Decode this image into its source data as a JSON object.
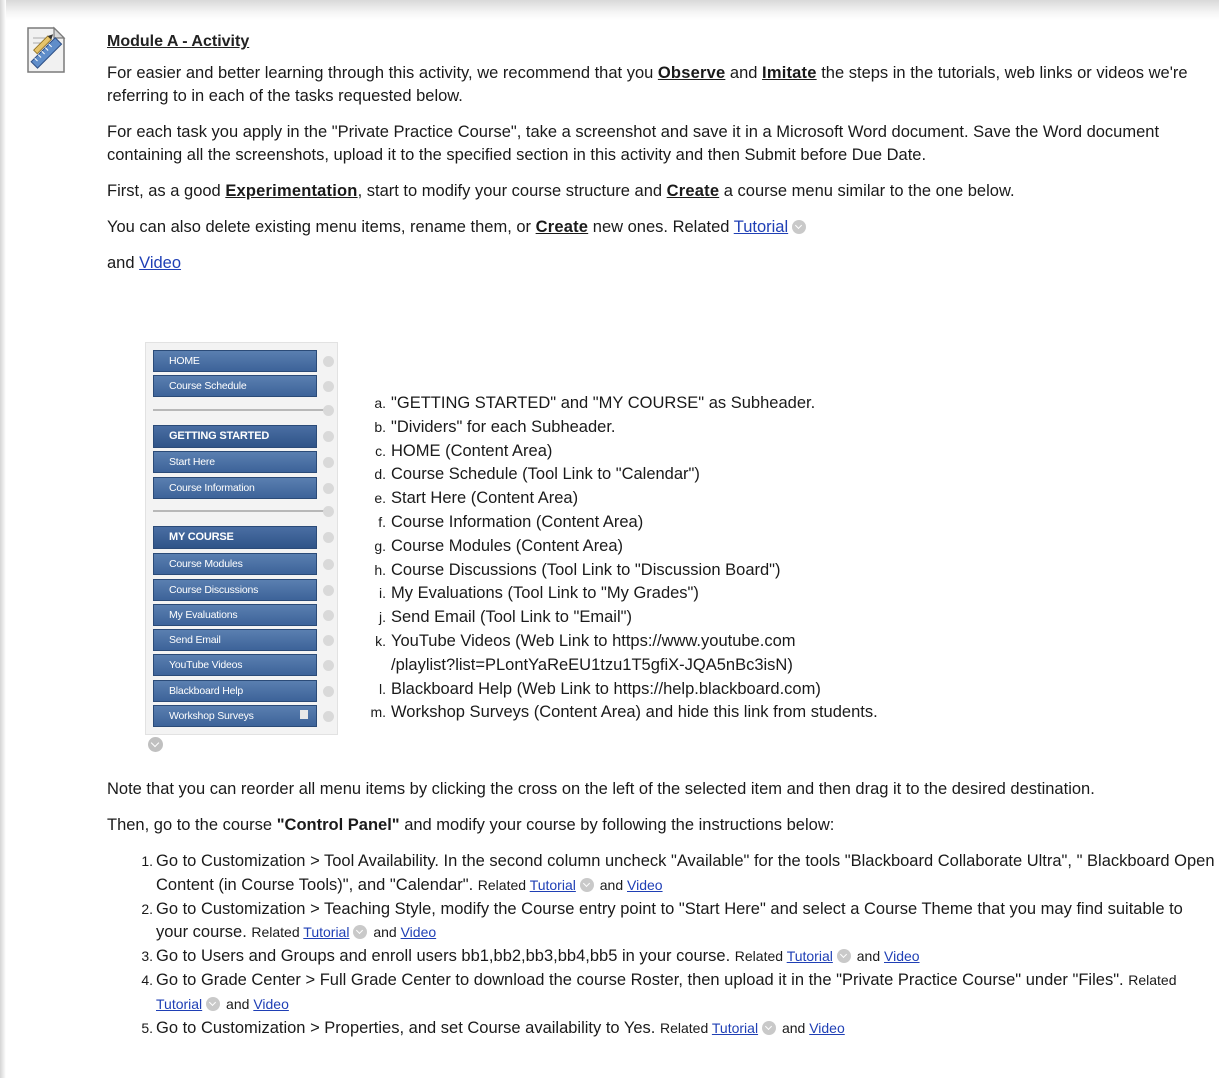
{
  "title": "Module A - Activity",
  "intro": {
    "p1": {
      "t1": "For easier and better learning through this activity, we recommend that you ",
      "kw1": "Observe",
      "t2": " and ",
      "kw2": "Imitate",
      "t3": " the steps in the tutorials, web links or videos we're referring to in each of the tasks requested below."
    },
    "p2": "For each task you apply in the \"Private Practice Course\", take a screenshot and save it in a Microsoft Word document. Save the Word document containing all the screenshots, upload it to the specified section in this activity and then Submit before Due Date.",
    "p3": {
      "t1": "First, as a good ",
      "kw1": "Experimentation",
      "t2": ", start to modify your course structure and ",
      "kw2": "Create",
      "t3": " a course menu similar to the one below."
    },
    "p4": {
      "t1": "You can also delete existing menu items, rename them, or ",
      "kw1": "Create",
      "t2": " new ones. Related ",
      "link": "Tutorial"
    },
    "p5": {
      "t1": "and ",
      "link": "Video"
    }
  },
  "course_menu": [
    {
      "label": "HOME",
      "type": "item"
    },
    {
      "label": "Course Schedule",
      "type": "item"
    },
    {
      "label": "GETTING STARTED",
      "type": "subheader"
    },
    {
      "label": "Start Here",
      "type": "item"
    },
    {
      "label": "Course Information",
      "type": "item"
    },
    {
      "label": "MY COURSE",
      "type": "subheader"
    },
    {
      "label": "Course Modules",
      "type": "item"
    },
    {
      "label": "Course Discussions",
      "type": "item"
    },
    {
      "label": "My Evaluations",
      "type": "item"
    },
    {
      "label": "Send Email",
      "type": "item"
    },
    {
      "label": "YouTube Videos",
      "type": "item"
    },
    {
      "label": "Blackboard Help",
      "type": "item"
    },
    {
      "label": "Workshop Surveys",
      "type": "item"
    }
  ],
  "menu_requirements": [
    {
      "mark": "a.",
      "text": "\"GETTING STARTED\" and \"MY COURSE\" as Subheader."
    },
    {
      "mark": "b.",
      "text": "\"Dividers\" for each Subheader."
    },
    {
      "mark": "c.",
      "text": "HOME (Content Area)"
    },
    {
      "mark": "d.",
      "text": "Course Schedule (Tool Link to \"Calendar\")"
    },
    {
      "mark": "e.",
      "text": "Start Here (Content Area)"
    },
    {
      "mark": "f.",
      "text": "Course Information (Content Area)"
    },
    {
      "mark": "g.",
      "text": "Course Modules (Content Area)"
    },
    {
      "mark": "h.",
      "text": "Course Discussions (Tool Link to \"Discussion Board\")"
    },
    {
      "mark": "i.",
      "text": "My Evaluations (Tool Link to \"My Grades\")"
    },
    {
      "mark": "j.",
      "text": "Send Email (Tool Link to \"Email\")"
    },
    {
      "mark": "k.",
      "text": "YouTube Videos (Web Link to https://www.youtube.com"
    },
    {
      "mark": "",
      "text": "/playlist?list=PLontYaReEU1tzu1T5gfiX-JQA5nBc3isN)"
    },
    {
      "mark": "l.",
      "text": "Blackboard Help (Web Link to https://help.blackboard.com)"
    },
    {
      "mark": "m.",
      "text": "Workshop Surveys (Content Area) and hide this link from students."
    }
  ],
  "note": "Note that you can reorder all menu items by clicking the cross on the left of the selected item and then drag it to the desired destination.",
  "then": {
    "t1": "Then, go to the course ",
    "kw": "\"Control Panel\"",
    "t2": " and modify your course by following the instructions below:"
  },
  "steps": [
    {
      "num": "1.",
      "text": "Go to Customization > Tool Availability. In the second column uncheck \"Available\" for the tools \"Blackboard Collaborate Ultra\", \" Blackboard Open Content (in Course Tools)\", and \"Calendar\". ",
      "related": "Related ",
      "tutorial": "Tutorial",
      "and": " and ",
      "video": "Video"
    },
    {
      "num": "2.",
      "text": "Go to Customization > Teaching Style, modify the Course entry point to \"Start Here\" and select a Course Theme that you may find suitable to your course. ",
      "related": "Related ",
      "tutorial": "Tutorial",
      "and": " and ",
      "video": "Video"
    },
    {
      "num": "3.",
      "text": "Go to Users and Groups and enroll users bb1,bb2,bb3,bb4,bb5 in your course. ",
      "related": "Related ",
      "tutorial": "Tutorial",
      "and": " and ",
      "video": "Video"
    },
    {
      "num": "4.",
      "text": "Go to Grade Center > Full Grade Center to download the course Roster, then upload it in the \"Private Practice Course\" under \"Files\". ",
      "related": "Related ",
      "tutorial": "Tutorial",
      "and": " and ",
      "video": "Video"
    },
    {
      "num": "5.",
      "text": "Go to Customization > Properties, and set Course availability to Yes. ",
      "related": "Related ",
      "tutorial": "Tutorial",
      "and": " and ",
      "video": "Video"
    }
  ]
}
